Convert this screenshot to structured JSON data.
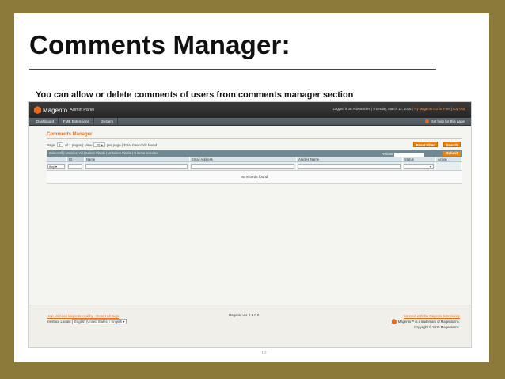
{
  "slide": {
    "title": "Comments Manager:",
    "subtitle": "You can allow  or  delete comments of users from comments manager  section",
    "page_number": "12"
  },
  "header": {
    "brand": "Magento",
    "panel_label": "Admin Panel",
    "logged_in": "Logged in as Adv-articles  |  Thursday, March 12, 2015  |",
    "try_link": "Try Magento Go for Free",
    "logout_link": "Log Out"
  },
  "nav": {
    "items": [
      "Dashboard",
      "FME Extensions",
      "System"
    ],
    "help": "Get help for this page"
  },
  "grid": {
    "page_title": "Comments Manager",
    "page_label": "Page",
    "page_value": "1",
    "of_pages": "of 1 pages  |  View",
    "per_page_value": "20",
    "per_page_label": "per page  |  Total 0 records found",
    "reset_filter": "Reset Filter",
    "search": "Search",
    "mass_links": "Select All  |  Unselect All  |  Select Visible  |  Unselect Visible  |  0 items selected",
    "actions_label": "Actions",
    "submit": "Submit",
    "columns": [
      "",
      "ID",
      "Name",
      "Email Address",
      "Articles Name",
      "Status",
      "Action"
    ],
    "filter_any": "Any",
    "empty_text": "No records found."
  },
  "footer": {
    "help_link": "Help Us Keep Magento Healthy - Report All Bugs",
    "locale_label": "Interface Locale:",
    "locale_value": "English (United States) / English",
    "version": "Magento ver. 1.9.0.0",
    "community_link": "Connect with the Magento Community",
    "trademark": "Magento™ is a trademark of Magento Inc.",
    "copyright": "Copyright © 2015 Magento Inc."
  }
}
